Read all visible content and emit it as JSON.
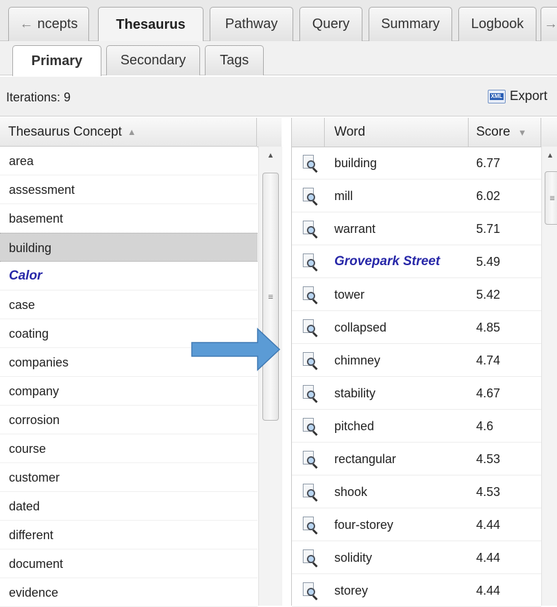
{
  "top_tabs": [
    {
      "label": "ncepts",
      "active": false
    },
    {
      "label": "Thesaurus",
      "active": true
    },
    {
      "label": "Pathway",
      "active": false
    },
    {
      "label": "Query",
      "active": false
    },
    {
      "label": "Summary",
      "active": false
    },
    {
      "label": "Logbook",
      "active": false
    }
  ],
  "sub_tabs": [
    {
      "label": "Primary",
      "active": true
    },
    {
      "label": "Secondary",
      "active": false
    },
    {
      "label": "Tags",
      "active": false
    }
  ],
  "toolbar": {
    "iterations_label": "Iterations: 9",
    "export_label": "Export"
  },
  "left_grid": {
    "header": "Thesaurus Concept",
    "rows": [
      {
        "label": "area"
      },
      {
        "label": "assessment"
      },
      {
        "label": "basement"
      },
      {
        "label": "building",
        "selected": true
      },
      {
        "label": "Calor",
        "highlight": true
      },
      {
        "label": "case"
      },
      {
        "label": "coating"
      },
      {
        "label": "companies"
      },
      {
        "label": "company"
      },
      {
        "label": "corrosion"
      },
      {
        "label": "course"
      },
      {
        "label": "customer"
      },
      {
        "label": "dated"
      },
      {
        "label": "different"
      },
      {
        "label": "document"
      },
      {
        "label": "evidence"
      }
    ]
  },
  "right_grid": {
    "headers": {
      "word": "Word",
      "score": "Score"
    },
    "rows": [
      {
        "word": "building",
        "score": "6.77"
      },
      {
        "word": "mill",
        "score": "6.02"
      },
      {
        "word": "warrant",
        "score": "5.71"
      },
      {
        "word": "Grovepark Street",
        "score": "5.49",
        "highlight": true
      },
      {
        "word": "tower",
        "score": "5.42"
      },
      {
        "word": "collapsed",
        "score": "4.85"
      },
      {
        "word": "chimney",
        "score": "4.74"
      },
      {
        "word": "stability",
        "score": "4.67"
      },
      {
        "word": "pitched",
        "score": "4.6"
      },
      {
        "word": "rectangular",
        "score": "4.53"
      },
      {
        "word": "shook",
        "score": "4.53"
      },
      {
        "word": "four-storey",
        "score": "4.44"
      },
      {
        "word": "solidity",
        "score": "4.44"
      },
      {
        "word": "storey",
        "score": "4.44"
      }
    ]
  },
  "icons": {
    "row_icon": "magnifier-document-icon",
    "export_icon": "xml-file-icon",
    "tab_left": "arrow-left-icon",
    "tab_right": "arrow-right-icon"
  },
  "colors": {
    "highlight_text": "#2727a8",
    "selected_row": "#d4d4d4",
    "arrow_fill": "#5b9bd5"
  }
}
